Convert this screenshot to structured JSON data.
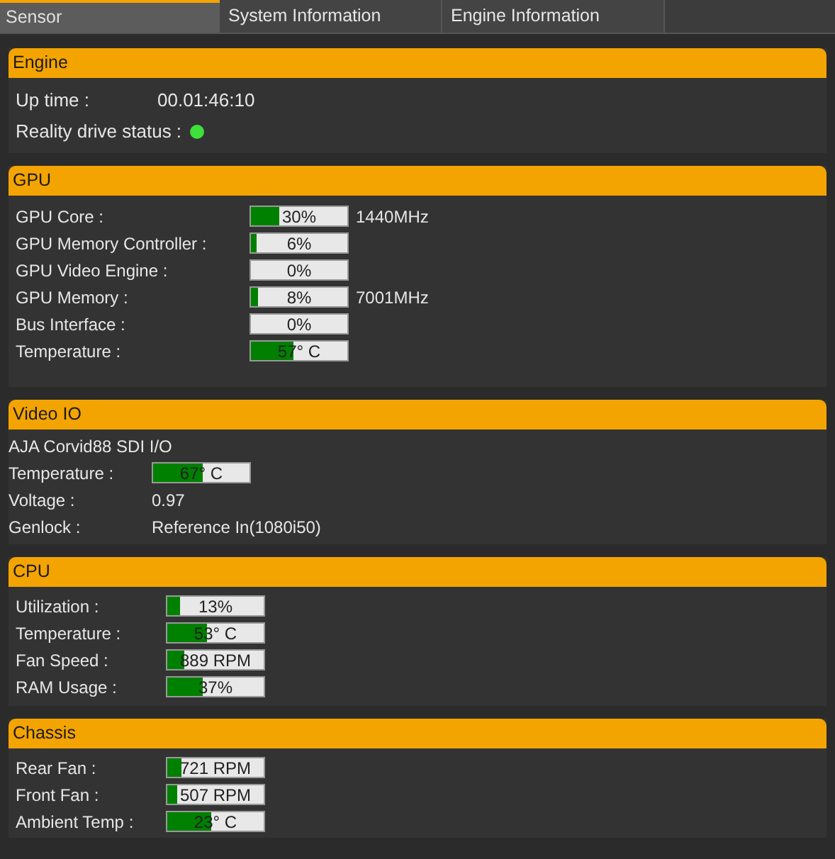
{
  "tabs": [
    {
      "label": "Sensor",
      "selected": true
    },
    {
      "label": "System Information",
      "selected": false
    },
    {
      "label": "Engine Information",
      "selected": false
    }
  ],
  "sections": [
    {
      "title": "Engine",
      "rows": [
        {
          "kind": "value",
          "label": "Up time :",
          "value": "00.01:46:10"
        },
        {
          "kind": "status",
          "label": "Reality drive status :",
          "on": true
        }
      ]
    },
    {
      "title": "GPU",
      "rows": [
        {
          "kind": "gauge",
          "label": "GPU Core :",
          "level": 0.3,
          "reading": "30%",
          "extra": "1440MHz"
        },
        {
          "kind": "gauge",
          "label": "GPU Memory Controller :",
          "level": 0.06,
          "reading": "6%"
        },
        {
          "kind": "gauge",
          "label": "GPU Video Engine :",
          "level": 0,
          "reading": "0%"
        },
        {
          "kind": "gauge",
          "label": "GPU Memory :",
          "level": 0.08,
          "reading": "8%",
          "extra": "7001MHz"
        },
        {
          "kind": "gauge",
          "label": "Bus Interface :",
          "level": 0,
          "reading": "0%"
        },
        {
          "kind": "gauge",
          "label": "Temperature :",
          "level": 0.44,
          "reading": "57° C"
        }
      ]
    },
    {
      "title": "Video IO",
      "rows": [
        {
          "kind": "caption",
          "text": "AJA Corvid88 SDI I/O"
        },
        {
          "kind": "gauge",
          "label": "Temperature :",
          "level": 0.51,
          "reading": "67° C"
        },
        {
          "kind": "value",
          "label": "Voltage :",
          "value": "0.97"
        },
        {
          "kind": "value",
          "label": "Genlock :",
          "value": "Reference In(1080i50)"
        }
      ]
    },
    {
      "title": "CPU",
      "rows": [
        {
          "kind": "gauge",
          "label": "Utilization :",
          "level": 0.13,
          "reading": "13%"
        },
        {
          "kind": "gauge",
          "label": "Temperature :",
          "level": 0.41,
          "reading": "53° C"
        },
        {
          "kind": "gauge",
          "label": "Fan Speed :",
          "level": 0.17,
          "reading": "889 RPM"
        },
        {
          "kind": "gauge",
          "label": "RAM Usage :",
          "level": 0.37,
          "reading": "37%"
        }
      ]
    },
    {
      "title": "Chassis",
      "rows": [
        {
          "kind": "gauge",
          "label": "Rear Fan :",
          "level": 0.14,
          "reading": "721 RPM"
        },
        {
          "kind": "gauge",
          "label": "Front Fan :",
          "level": 0.1,
          "reading": "507 RPM"
        },
        {
          "kind": "gauge",
          "label": "Ambient Temp :",
          "level": 0.46,
          "reading": "23° C"
        }
      ]
    }
  ]
}
